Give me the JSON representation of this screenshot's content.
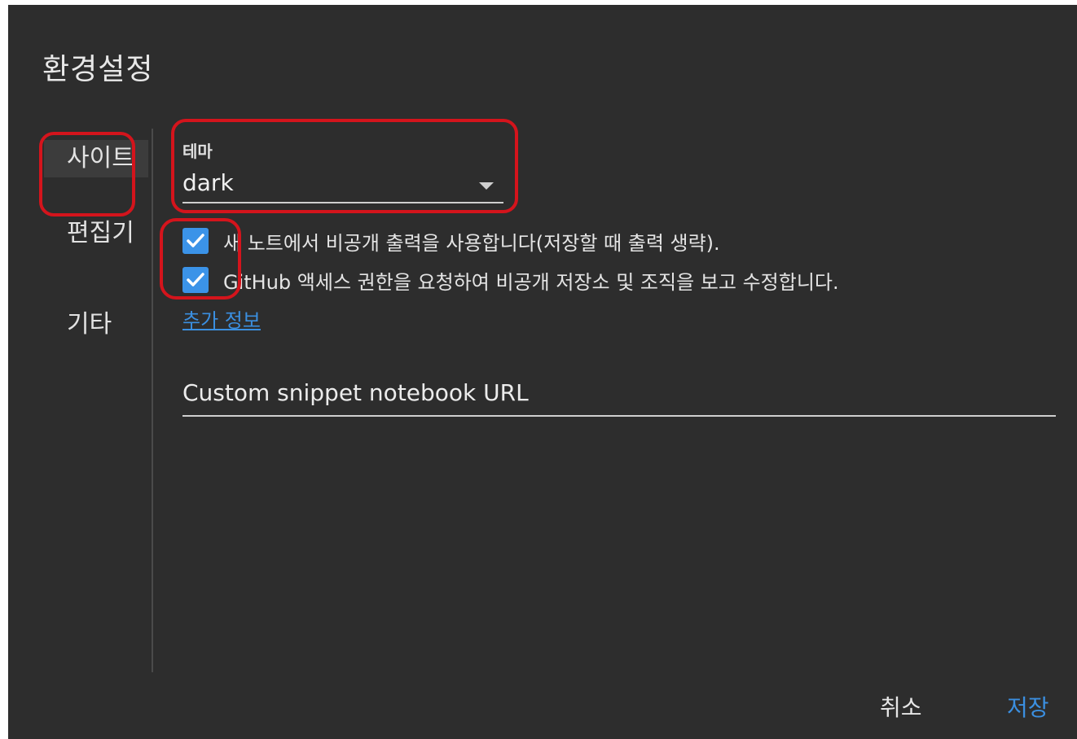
{
  "dialog": {
    "title": "환경설정"
  },
  "sidebar": {
    "items": [
      {
        "label": "사이트",
        "active": true
      },
      {
        "label": "편집기",
        "active": false
      },
      {
        "label": "기타",
        "active": false
      }
    ]
  },
  "theme": {
    "label": "테마",
    "value": "dark"
  },
  "options": [
    {
      "label": "새 노트에서 비공개 출력을 사용합니다(저장할 때 출력 생략).",
      "checked": true
    },
    {
      "label": "GitHub 액세스 권한을 요청하여 비공개 저장소 및 조직을 보고 수정합니다.",
      "checked": true
    }
  ],
  "more_info_link": "추가 정보",
  "snippet_url": {
    "placeholder": "Custom snippet notebook URL",
    "value": ""
  },
  "footer": {
    "cancel_label": "취소",
    "save_label": "저장"
  },
  "colors": {
    "background": "#2d2d2d",
    "accent": "#3b8fe0",
    "checkbox": "#3b93e8",
    "highlight": "#d4141c"
  }
}
